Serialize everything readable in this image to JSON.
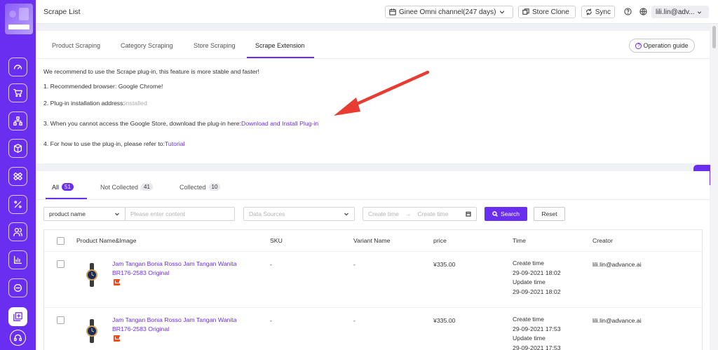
{
  "header": {
    "title": "Scrape List",
    "store_select": "Ginee Omni channel(247 days)",
    "store_clone": "Store Clone",
    "sync": "Sync",
    "user": "lili.lin@adv..."
  },
  "sidebar": {
    "items": [
      {
        "icon": "dashboard-icon"
      },
      {
        "icon": "cart-icon"
      },
      {
        "icon": "sitemap-icon"
      },
      {
        "icon": "box-icon"
      },
      {
        "icon": "dropbox-icon"
      },
      {
        "icon": "percent-icon"
      },
      {
        "icon": "users-icon"
      },
      {
        "icon": "report-icon"
      },
      {
        "icon": "chat-icon"
      },
      {
        "icon": "scrape-icon",
        "active": true
      }
    ]
  },
  "scrape_tabs": [
    "Product Scraping",
    "Category Scraping",
    "Store Scraping",
    "Scrape Extension"
  ],
  "active_tab": "Scrape Extension",
  "operation_guide": "Operation guide",
  "extension": {
    "intro": "We recommend to use the Scrape plug-in, this feature is more stable and faster!",
    "step1": "1. Recommended browser: Google Chrome!",
    "step2_label": "2. Plug-in installation address:",
    "step2_value": "installed",
    "step3_label": "3. When you cannot access the Google Store, download the plug-in here:",
    "step3_link": "Download and Install Plug-in",
    "step4_label": "4. For how to use the plug-in, please refer to:",
    "step4_link": "Tutorial"
  },
  "filter_tabs": [
    {
      "label": "All",
      "count": "51"
    },
    {
      "label": "Not Collected",
      "count": "41"
    },
    {
      "label": "Collected",
      "count": "10"
    }
  ],
  "filters": {
    "field_select": "product name",
    "content_placeholder": "Please enter content",
    "data_sources_placeholder": "Data Sources",
    "create_time_start": "Create time",
    "create_time_end": "Create time",
    "arrow": "→",
    "search": "Search",
    "reset": "Reset"
  },
  "table": {
    "headers": [
      "Product Name&Image",
      "SKU",
      "Variant Name",
      "price",
      "Time",
      "Creator"
    ],
    "rows": [
      {
        "name": "Jam Tangan Bonia Rosso Jam Tangan Wanita BR176-2583 Original",
        "sku": "-",
        "variant": "-",
        "price": "¥335.00",
        "create_label": "Create time",
        "create_time": "29-09-2021 18:02",
        "update_label": "Update time",
        "update_time": "29-09-2021 18:02",
        "creator": "lili.lin@advance.ai"
      },
      {
        "name": "Jam Tangan Bonia Rosso Jam Tangan Wanita BR176-2583 Original",
        "sku": "-",
        "variant": "-",
        "price": "¥335.00",
        "create_label": "Create time",
        "create_time": "29-09-2021 17:53",
        "update_label": "Update time",
        "update_time": "29-09-2021 17:53",
        "creator": "lili.lin@advance.ai"
      }
    ]
  },
  "colors": {
    "accent": "#6a2ef0",
    "arrow": "#e83c32",
    "shop": "#f04a1e"
  }
}
